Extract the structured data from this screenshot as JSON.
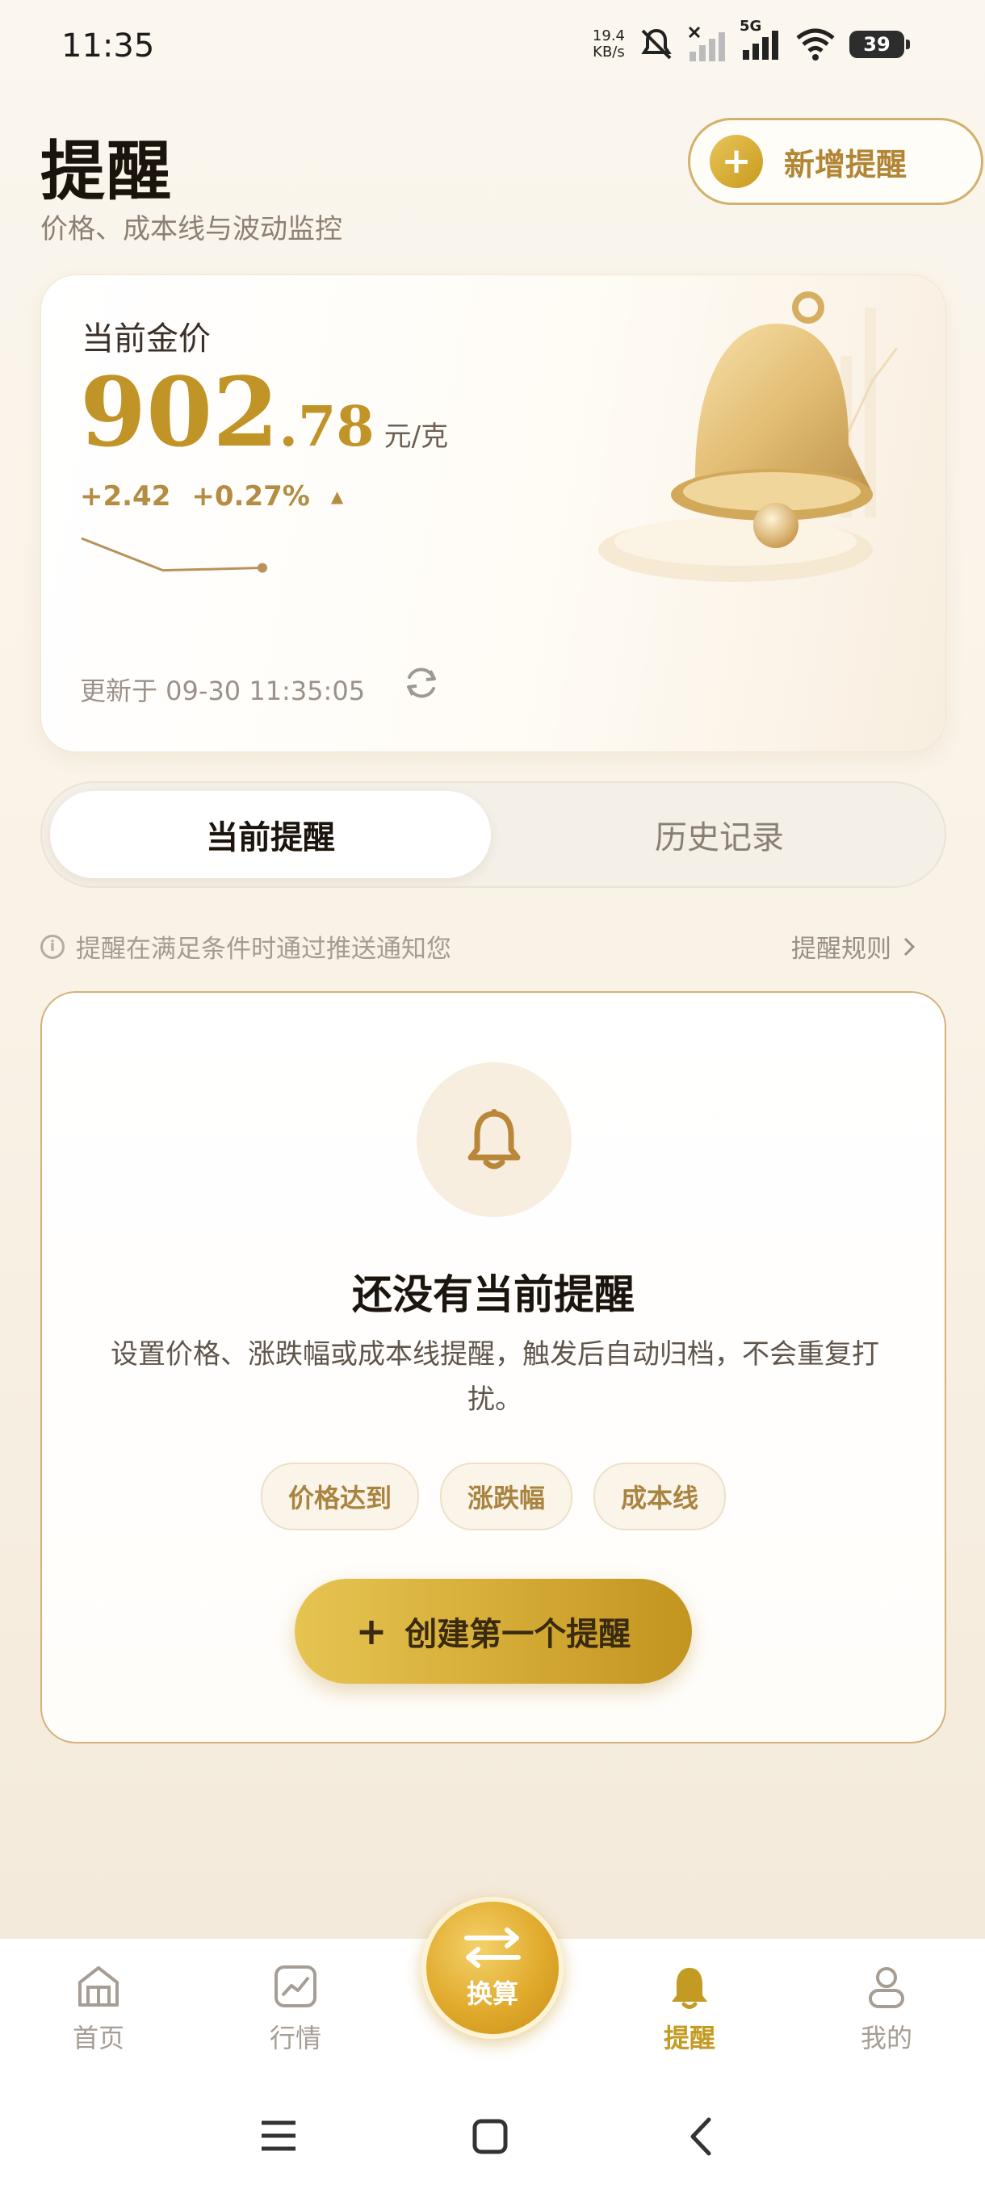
{
  "status_bar": {
    "time": "11:35",
    "net_speed_value": "19.4",
    "net_speed_unit": "KB/s",
    "network": "5G",
    "battery": "39"
  },
  "header": {
    "title": "提醒",
    "subtitle": "价格、成本线与波动监控",
    "add_button_label": "新增提醒"
  },
  "price_card": {
    "label": "当前金价",
    "price_int": "902",
    "price_dec": ".78",
    "unit": "元/克",
    "change_abs": "+2.42",
    "change_pct": "+0.27%",
    "sparkline": [
      0.0,
      0.62,
      0.57
    ],
    "updated": "更新于 09-30 11:35:05"
  },
  "tabs": {
    "current": "当前提醒",
    "history": "历史记录"
  },
  "info": {
    "text": "提醒在满足条件时通过推送通知您",
    "rules_link": "提醒规则"
  },
  "empty_state": {
    "title": "还没有当前提醒",
    "description": "设置价格、涨跌幅或成本线提醒，触发后自动归档，不会重复打扰。",
    "chips": [
      "价格达到",
      "涨跌幅",
      "成本线"
    ],
    "create_button": "创建第一个提醒"
  },
  "nav": {
    "home": "首页",
    "market": "行情",
    "convert": "换算",
    "alerts": "提醒",
    "mine": "我的"
  },
  "colors": {
    "accent_gold": "#c39b22",
    "price_gold": "#c19428",
    "border_gold": "#d3b27a"
  }
}
